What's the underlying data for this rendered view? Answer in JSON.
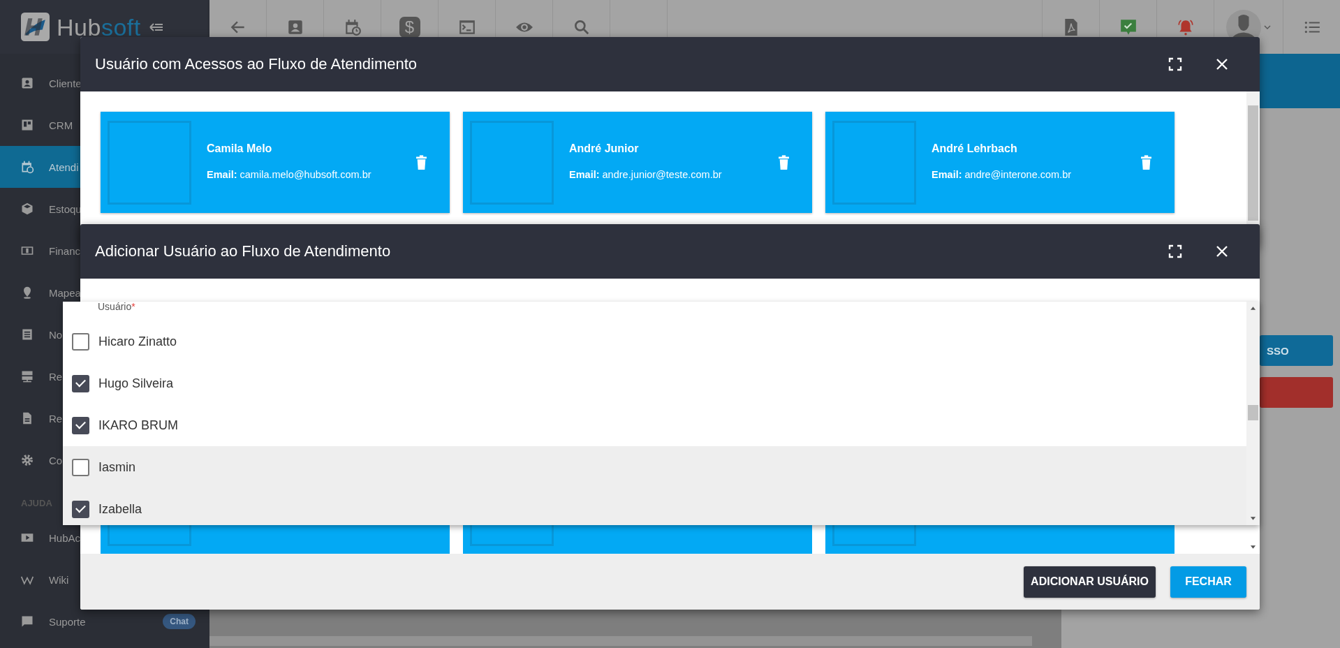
{
  "logo": {
    "part_1": "Hub",
    "part_2": "soft"
  },
  "sidebar": {
    "items": [
      {
        "label": "Cliente",
        "selected": false
      },
      {
        "label": "CRM",
        "selected": false
      },
      {
        "label": "Atendi",
        "selected": true
      },
      {
        "label": "Estoqu",
        "selected": false
      },
      {
        "label": "Financ",
        "selected": false
      },
      {
        "label": "Mapea",
        "selected": false
      },
      {
        "label": "No",
        "selected": false
      },
      {
        "label": "Re",
        "selected": false
      },
      {
        "label": "Re",
        "selected": false
      },
      {
        "label": "Co",
        "selected": false
      }
    ],
    "help_heading": "AJUDA",
    "help_items": [
      {
        "label": "HubAc"
      },
      {
        "label": "Wiki"
      },
      {
        "label": "Suporte",
        "badge": "Chat"
      }
    ]
  },
  "toolbar": {
    "dollar_key": "$"
  },
  "side_panel": {
    "buttons": [
      {
        "label": "SSO",
        "kind": "primary"
      },
      {
        "kind": "danger"
      }
    ]
  },
  "access_dialog": {
    "title": "Usuário com Acessos ao Fluxo de Atendimento",
    "users": [
      {
        "name": "Camila Melo",
        "email": "**Email:** camila.melo@hubsoft.com.br"
      },
      {
        "name": "André Junior",
        "email": "**Email:** andre.junior@teste.com.br"
      },
      {
        "name": "André Lehrbach",
        "email": "**Email:** andre@interone.com.br"
      }
    ]
  },
  "add_dialog": {
    "title": "Adicionar Usuário ao Fluxo de Atendimento",
    "field_label": "Usuário",
    "required_mark": "*",
    "options": [
      {
        "label": "Hicaro Zinatto",
        "checked": false,
        "highlighted": false
      },
      {
        "label": "Hugo Silveira",
        "checked": true,
        "highlighted": false
      },
      {
        "label": "IKARO BRUM",
        "checked": true,
        "highlighted": false
      },
      {
        "label": "Iasmin",
        "checked": false,
        "highlighted": true
      },
      {
        "label": "Izabella",
        "checked": true,
        "highlighted": true
      }
    ],
    "buttons": [
      {
        "label": "ADICIONAR USUÁRIO",
        "kind": "dark"
      },
      {
        "label": "FECHAR",
        "kind": "primary"
      }
    ]
  }
}
